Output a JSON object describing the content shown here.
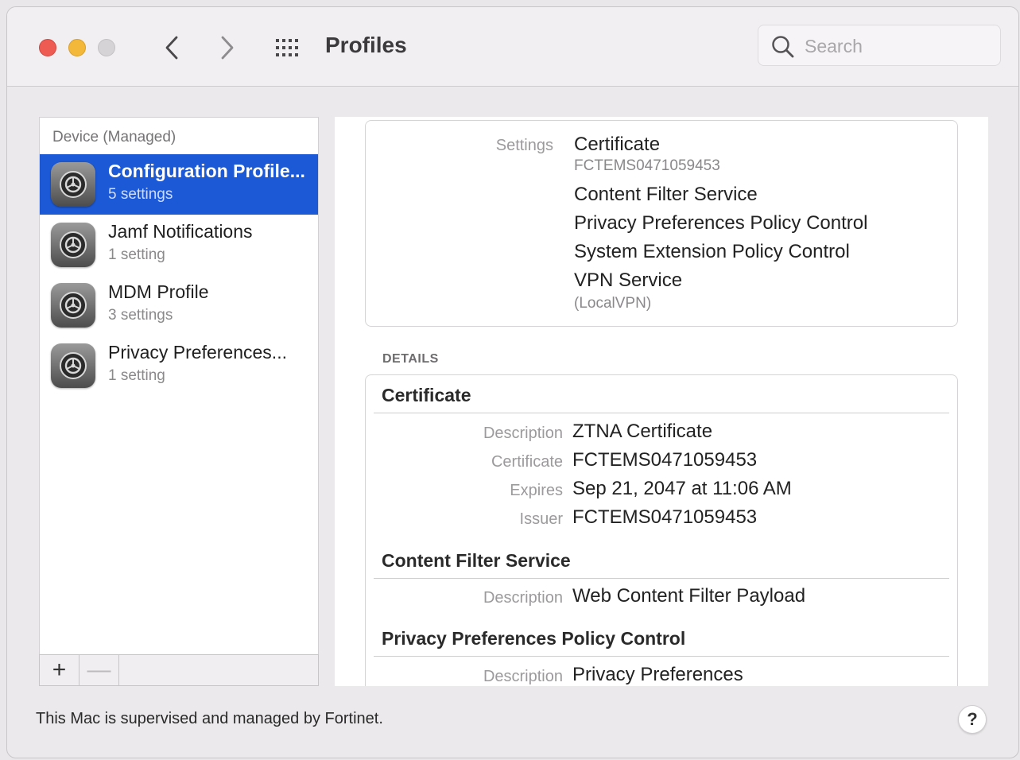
{
  "window": {
    "title": "Profiles",
    "search_placeholder": "Search"
  },
  "sidebar": {
    "header": "Device (Managed)",
    "items": [
      {
        "title": "Configuration Profile...",
        "subtitle": "5 settings",
        "selected": true,
        "icon": "system-preferences-gear-icon"
      },
      {
        "title": "Jamf Notifications",
        "subtitle": "1 setting",
        "selected": false,
        "icon": "system-preferences-gear-icon"
      },
      {
        "title": "MDM Profile",
        "subtitle": "3 settings",
        "selected": false,
        "icon": "system-preferences-gear-icon"
      },
      {
        "title": "Privacy Preferences...",
        "subtitle": "1 setting",
        "selected": false,
        "icon": "system-preferences-gear-icon"
      }
    ],
    "toolbar": {
      "add_label": "+",
      "remove_label": "—"
    }
  },
  "settings": {
    "label": "Settings",
    "items": [
      {
        "name": "Certificate",
        "sub": "FCTEMS0471059453"
      },
      {
        "name": "Content Filter Service",
        "sub": ""
      },
      {
        "name": "Privacy Preferences Policy Control",
        "sub": ""
      },
      {
        "name": "System Extension Policy Control",
        "sub": ""
      },
      {
        "name": "VPN Service",
        "sub": "(LocalVPN)"
      }
    ]
  },
  "details": {
    "header": "DETAILS",
    "sections": [
      {
        "title": "Certificate",
        "rows": [
          {
            "label": "Description",
            "value": "ZTNA Certificate"
          },
          {
            "label": "Certificate",
            "value": "FCTEMS0471059453"
          },
          {
            "label": "Expires",
            "value": "Sep 21, 2047 at 11:06 AM"
          },
          {
            "label": "Issuer",
            "value": "FCTEMS0471059453"
          }
        ]
      },
      {
        "title": "Content Filter Service",
        "rows": [
          {
            "label": "Description",
            "value": "Web Content Filter Payload"
          }
        ]
      },
      {
        "title": "Privacy Preferences Policy Control",
        "rows": [
          {
            "label": "Description",
            "value": "Privacy Preferences"
          }
        ]
      }
    ]
  },
  "footer": {
    "text": "This Mac is supervised and managed by Fortinet.",
    "help_label": "?"
  },
  "colors": {
    "selection": "#1b59d7",
    "close": "#ee5b53",
    "minimize": "#f3b83a",
    "zoom_disabled": "#d6d3d6"
  }
}
